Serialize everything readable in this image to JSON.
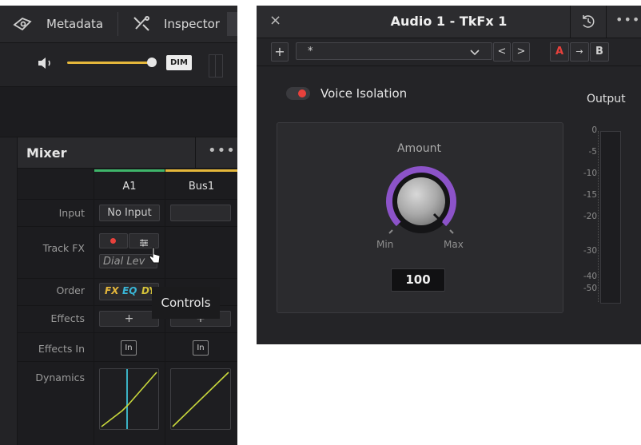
{
  "left_panel": {
    "tabs": [
      {
        "label": "Metadata",
        "icon": "metadata-icon"
      },
      {
        "label": "Inspector",
        "icon": "inspector-icon"
      }
    ],
    "volume": {
      "level": 0.95,
      "dim_label": "DIM"
    },
    "mixer": {
      "title": "Mixer",
      "more": "•••",
      "channels": [
        {
          "name": "A1",
          "color": "#3fb56a"
        },
        {
          "name": "Bus1",
          "color": "#e5b73b"
        }
      ],
      "rows": {
        "input": "Input",
        "track_fx": "Track FX",
        "order": "Order",
        "effects": "Effects",
        "effects_in": "Effects In",
        "dynamics": "Dynamics"
      },
      "input_values": [
        "No Input",
        ""
      ],
      "dial_label": "Dial Lev",
      "order_tags": [
        {
          "text": "FX",
          "color": "#e5b73b"
        },
        {
          "text": "EQ",
          "color": "#39b5d6"
        },
        {
          "text": "DY",
          "color": "#d4c23a"
        }
      ],
      "plus": "+",
      "in_label": "In"
    },
    "tooltip": "Controls"
  },
  "right_panel": {
    "title": "Audio 1 - TkFx 1",
    "close": "×",
    "more": "•••",
    "toolbar": {
      "add": "+",
      "preset": "*",
      "prev": "<",
      "next": ">",
      "a": "A",
      "arrow": "→",
      "b": "B"
    },
    "voice_isolation": {
      "label": "Voice Isolation",
      "on": true
    },
    "amount": {
      "label": "Amount",
      "min": "Min",
      "max": "Max",
      "value": "100"
    },
    "output": {
      "label": "Output",
      "scale": [
        "0",
        "-5",
        "-10",
        "-15",
        "-20",
        "-30",
        "-40",
        "-50"
      ]
    },
    "colors": {
      "knob_ring": "#8c53c9",
      "red": "#e8413c",
      "accent": "#e5b73b"
    }
  }
}
